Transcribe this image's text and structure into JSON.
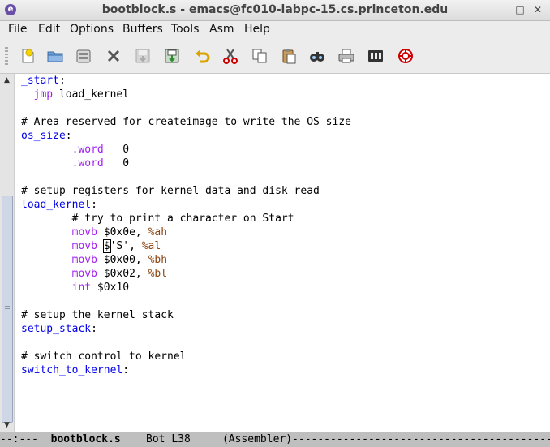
{
  "window": {
    "title": "bootblock.s - emacs@fc010-labpc-15.cs.princeton.edu",
    "icon": "emacs-icon",
    "controls": [
      "_",
      "□",
      "✕"
    ]
  },
  "menu": [
    "File",
    "Edit",
    "Options",
    "Buffers",
    "Tools",
    "Asm",
    "Help"
  ],
  "toolbar": [
    "new-file-icon",
    "open-folder-icon",
    "dired-icon",
    "close-buffer-icon",
    "save-icon",
    "save-as-icon",
    "undo-icon",
    "cut-icon",
    "copy-icon",
    "paste-icon",
    "search-icon",
    "print-icon",
    "customize-icon",
    "help-icon"
  ],
  "editor": {
    "lines": [
      [
        {
          "t": "_start",
          "c": "label"
        },
        {
          "t": ":",
          "c": ""
        }
      ],
      [
        {
          "t": "  ",
          "c": ""
        },
        {
          "t": "jmp",
          "c": "directive"
        },
        {
          "t": " load_kernel",
          "c": ""
        }
      ],
      [],
      [
        {
          "t": "# Area reserved for createimage to write the OS size",
          "c": ""
        }
      ],
      [
        {
          "t": "os_size",
          "c": "label"
        },
        {
          "t": ":",
          "c": ""
        }
      ],
      [
        {
          "t": "        ",
          "c": ""
        },
        {
          "t": ".word",
          "c": "directive"
        },
        {
          "t": "   0",
          "c": ""
        }
      ],
      [
        {
          "t": "        ",
          "c": ""
        },
        {
          "t": ".word",
          "c": "directive"
        },
        {
          "t": "   0",
          "c": ""
        }
      ],
      [],
      [
        {
          "t": "# setup registers for kernel data and disk read",
          "c": ""
        }
      ],
      [
        {
          "t": "load_kernel",
          "c": "label"
        },
        {
          "t": ":",
          "c": ""
        }
      ],
      [
        {
          "t": "        # try to print a character on Start",
          "c": ""
        }
      ],
      [
        {
          "t": "        ",
          "c": ""
        },
        {
          "t": "movb",
          "c": "directive"
        },
        {
          "t": " $0x0e, ",
          "c": ""
        },
        {
          "t": "%ah",
          "c": "reg"
        }
      ],
      [
        {
          "t": "        ",
          "c": ""
        },
        {
          "t": "movb",
          "c": "directive"
        },
        {
          "t": " ",
          "c": ""
        },
        {
          "t": "$",
          "c": "cursor"
        },
        {
          "t": "'S', ",
          "c": ""
        },
        {
          "t": "%al",
          "c": "reg"
        }
      ],
      [
        {
          "t": "        ",
          "c": ""
        },
        {
          "t": "movb",
          "c": "directive"
        },
        {
          "t": " $0x00, ",
          "c": ""
        },
        {
          "t": "%bh",
          "c": "reg"
        }
      ],
      [
        {
          "t": "        ",
          "c": ""
        },
        {
          "t": "movb",
          "c": "directive"
        },
        {
          "t": " $0x02, ",
          "c": ""
        },
        {
          "t": "%bl",
          "c": "reg"
        }
      ],
      [
        {
          "t": "        ",
          "c": ""
        },
        {
          "t": "int",
          "c": "directive"
        },
        {
          "t": " $0x10",
          "c": ""
        }
      ],
      [],
      [
        {
          "t": "# setup the kernel stack",
          "c": ""
        }
      ],
      [
        {
          "t": "setup_stack",
          "c": "label"
        },
        {
          "t": ":",
          "c": ""
        }
      ],
      [],
      [
        {
          "t": "# switch control to kernel",
          "c": ""
        }
      ],
      [
        {
          "t": "switch_to_kernel",
          "c": "label"
        },
        {
          "t": ":",
          "c": ""
        }
      ]
    ]
  },
  "modeline": {
    "status": "--:---  ",
    "buffer": "bootblock.s",
    "position": "    Bot L38     ",
    "mode": "(Assembler)",
    "fill": "------------------------------------------------"
  }
}
